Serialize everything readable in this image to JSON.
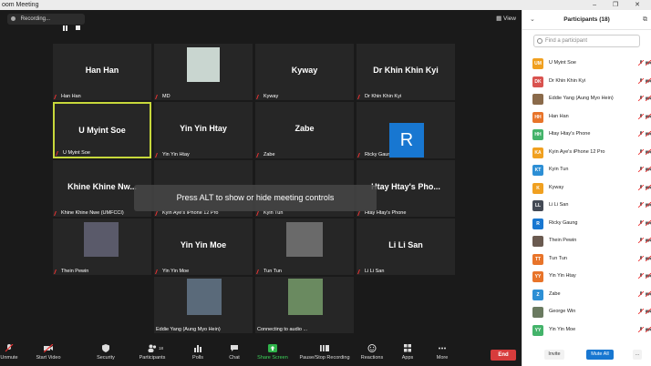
{
  "window": {
    "title": "oom Meeting"
  },
  "recording": {
    "label": "Recording..."
  },
  "view_label": "View",
  "toast": "Press ALT to show or hide meeting controls",
  "tiles": [
    {
      "name": "Han Han",
      "label": "Han Han"
    },
    {
      "name": "",
      "label": "MD"
    },
    {
      "name": "Kyway",
      "label": "Kyway"
    },
    {
      "name": "Dr Khin Khin Kyi",
      "label": "Dr Khin Khin Kyi"
    },
    {
      "name": "U Myint Soe",
      "label": "U Myint Soe"
    },
    {
      "name": "Yin Yin Htay",
      "label": "Yin Yin Htay"
    },
    {
      "name": "Zabe",
      "label": "Zabe"
    },
    {
      "name": "",
      "label": "Ricky Gaung"
    },
    {
      "name": "Khine Khine Nw...",
      "label": "Khine Khine Nwe (UMFCCI)"
    },
    {
      "name": "",
      "label": "Kyin Aye's iPhone 12 Pro"
    },
    {
      "name": "",
      "label": "Kyin Tun"
    },
    {
      "name": "Htay Htay's Pho...",
      "label": "Htay Htay's Phone"
    },
    {
      "name": "",
      "label": "Thein Pewin"
    },
    {
      "name": "Yin Yin Moe",
      "label": "Yin Yin Moe"
    },
    {
      "name": "",
      "label": "Tun Tun"
    },
    {
      "name": "Li Li San",
      "label": "Li Li San"
    },
    {
      "name": "",
      "label": "Eddie Yang (Aung Myo Hein)"
    },
    {
      "name": "",
      "label": "Connecting to audio ..."
    }
  ],
  "ricky_avatar_letter": "R",
  "toolbar": {
    "unmute": "Unmute",
    "start_video": "Start Video",
    "security": "Security",
    "participants": "Participants",
    "participants_count": "18",
    "polls": "Polls",
    "chat": "Chat",
    "share_screen": "Share Screen",
    "record": "Pause/Stop Recording",
    "reactions": "Reactions",
    "apps": "Apps",
    "more": "More",
    "end": "End"
  },
  "panel": {
    "title": "Participants (18)",
    "search_placeholder": "Find a participant",
    "participants": [
      {
        "initials": "UM",
        "name": "U Myint Soe",
        "color": "#f0a020"
      },
      {
        "initials": "DK",
        "name": "Dr Khin Khin Kyi",
        "color": "#d9534f"
      },
      {
        "initials": "",
        "name": "Eddie Yang (Aung Myo Hein)",
        "color": "#8a6a4a"
      },
      {
        "initials": "HH",
        "name": "Han Han",
        "color": "#e8742a"
      },
      {
        "initials": "HH",
        "name": "Htay Htay's Phone",
        "color": "#44b36a"
      },
      {
        "initials": "KA",
        "name": "Kyin Aye's iPhone 12 Pro",
        "color": "#f0a020"
      },
      {
        "initials": "KT",
        "name": "Kyin Tun",
        "color": "#2d8fd5"
      },
      {
        "initials": "K",
        "name": "Kyway",
        "color": "#f0a020"
      },
      {
        "initials": "LL",
        "name": "Li Li San",
        "color": "#444a55"
      },
      {
        "initials": "R",
        "name": "Ricky Gaung",
        "color": "#1877d1"
      },
      {
        "initials": "",
        "name": "Thein Pewin",
        "color": "#6a5a50"
      },
      {
        "initials": "TT",
        "name": "Tun Tun",
        "color": "#e8742a"
      },
      {
        "initials": "YY",
        "name": "Yin Yin Htay",
        "color": "#e8742a"
      },
      {
        "initials": "Z",
        "name": "Zabe",
        "color": "#2d8fd5"
      },
      {
        "initials": "",
        "name": "George Win",
        "color": "#6a7a60"
      },
      {
        "initials": "YY",
        "name": "Yin Yin Moe",
        "color": "#44b36a"
      }
    ],
    "invite": "Invite",
    "mute_all": "Mute All",
    "more": "..."
  },
  "colors": {
    "active_border": "#c7d83b",
    "end": "#d73c3c",
    "accent": "#1877d1"
  }
}
